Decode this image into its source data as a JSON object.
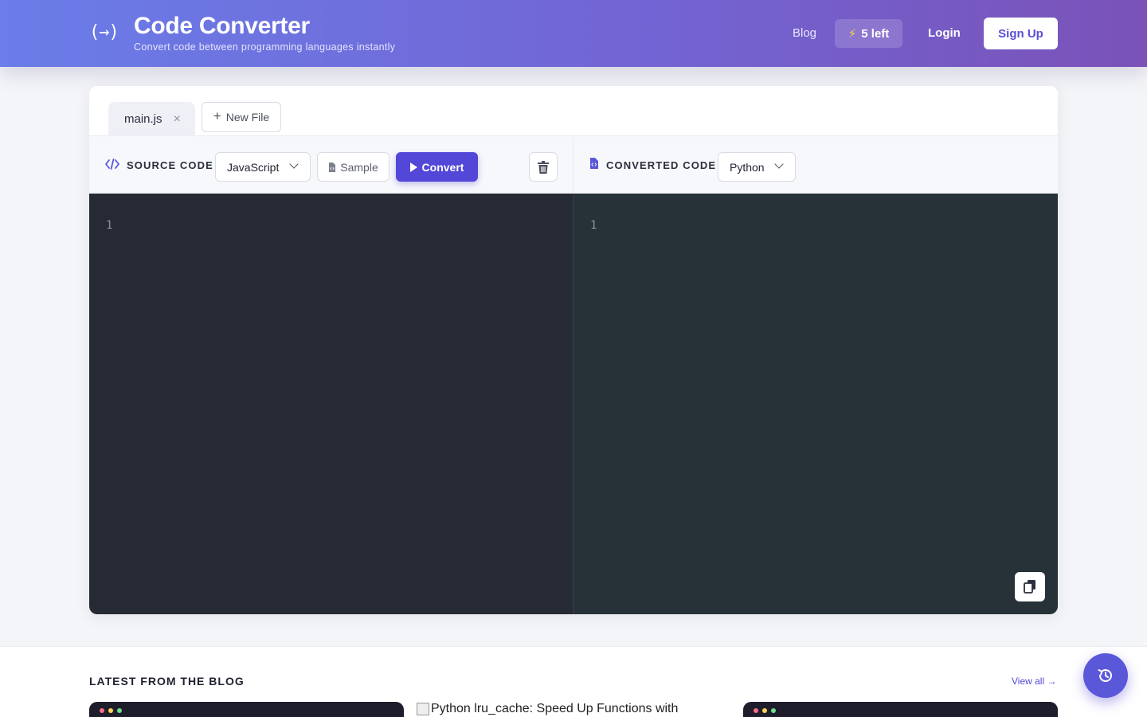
{
  "header": {
    "brand_icon": "(→)",
    "title": "Code Converter",
    "subtitle": "Convert code between programming languages instantly",
    "nav_blog": "Blog",
    "credits": "5 left",
    "credits_icon": "⚡",
    "login": "Login",
    "signup": "Sign Up"
  },
  "tabs": {
    "active_file": "main.js",
    "close_glyph": "×",
    "new_file": "New File"
  },
  "source": {
    "label": "SOURCE CODE",
    "language": "JavaScript",
    "sample": "Sample",
    "convert": "Convert",
    "line_number": "1"
  },
  "target": {
    "label": "CONVERTED CODE",
    "language": "Python",
    "line_number": "1"
  },
  "blog": {
    "title": "LATEST FROM THE BLOG",
    "view_all": "View all →",
    "card_image_alt": "Python lru_cache: Speed Up Functions with"
  },
  "colors": {
    "accent": "#5347d8",
    "header_start": "#6a7de8",
    "header_end": "#7a52b8",
    "editor_left_bg": "#262a35",
    "editor_right_bg": "#263238"
  }
}
